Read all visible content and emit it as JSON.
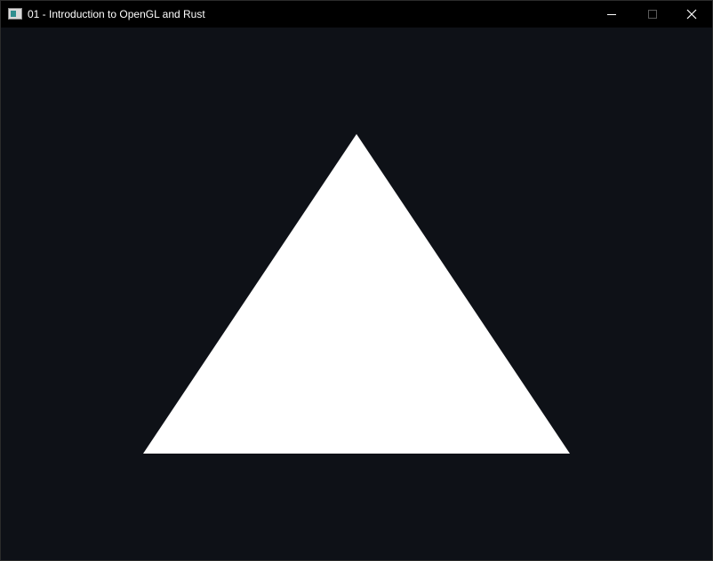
{
  "window": {
    "title": "01 - Introduction to OpenGL and Rust",
    "app_icon": "app-window-icon",
    "controls": {
      "minimize_icon": "minimize-icon",
      "maximize_icon": "maximize-icon",
      "close_icon": "close-icon"
    }
  },
  "viewport": {
    "clear_color": "#0e1117",
    "triangle_color": "#ffffff",
    "triangle_vertices_ndc": [
      [
        -0.6,
        -0.6
      ],
      [
        0.6,
        -0.6
      ],
      [
        0.0,
        0.6
      ]
    ]
  }
}
